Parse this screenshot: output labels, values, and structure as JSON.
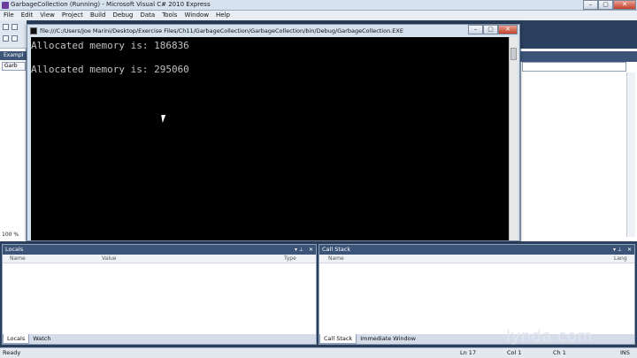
{
  "ide": {
    "title": "GarbageCollection (Running) - Microsoft Visual C# 2010 Express",
    "window_buttons": {
      "minimize": "–",
      "restore": "▢",
      "close": "✕"
    },
    "menu": [
      "File",
      "Edit",
      "View",
      "Project",
      "Build",
      "Debug",
      "Data",
      "Tools",
      "Window",
      "Help"
    ],
    "left_tab_label": "Exampl",
    "left_doc_tab": "Garb",
    "zoom": "100 %"
  },
  "console": {
    "title": "file:///C:/Users/Joe Marini/Desktop/Exercise Files/Ch11/GarbageCollection/GarbageCollection/bin/Debug/GarbageCollection.EXE",
    "buttons": {
      "minimize": "–",
      "restore": "▢",
      "close": "✕"
    },
    "lines": [
      "Allocated memory is: 186836",
      "",
      "Allocated memory is: 295060"
    ]
  },
  "locals_pane": {
    "title": "Locals",
    "columns": {
      "name": "Name",
      "value": "Value",
      "type": "Type"
    },
    "tabs": [
      "Locals",
      "Watch"
    ]
  },
  "callstack_pane": {
    "title": "Call Stack",
    "columns": {
      "name": "Name",
      "lang": "Lang"
    },
    "tabs": [
      "Call Stack",
      "Immediate Window"
    ]
  },
  "status": {
    "ready": "Ready",
    "line": "Ln 17",
    "col": "Col 1",
    "ch": "Ch 1",
    "mode": "INS"
  },
  "watermark": "lynda.com"
}
